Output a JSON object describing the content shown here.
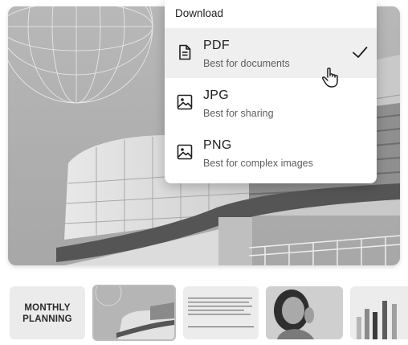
{
  "menu": {
    "title": "Download",
    "options": [
      {
        "name": "PDF",
        "desc": "Best for documents",
        "icon": "document-icon",
        "selected": true
      },
      {
        "name": "JPG",
        "desc": "Best for sharing",
        "icon": "image-icon",
        "selected": false
      },
      {
        "name": "PNG",
        "desc": "Best for complex images",
        "icon": "image-icon",
        "selected": false
      }
    ]
  },
  "thumbnails": {
    "t1": {
      "line1": "MONTHLY",
      "line2": "PLANNING"
    }
  },
  "colors": {
    "accent": "#1f1f1f",
    "selected_bg": "#efefef"
  }
}
